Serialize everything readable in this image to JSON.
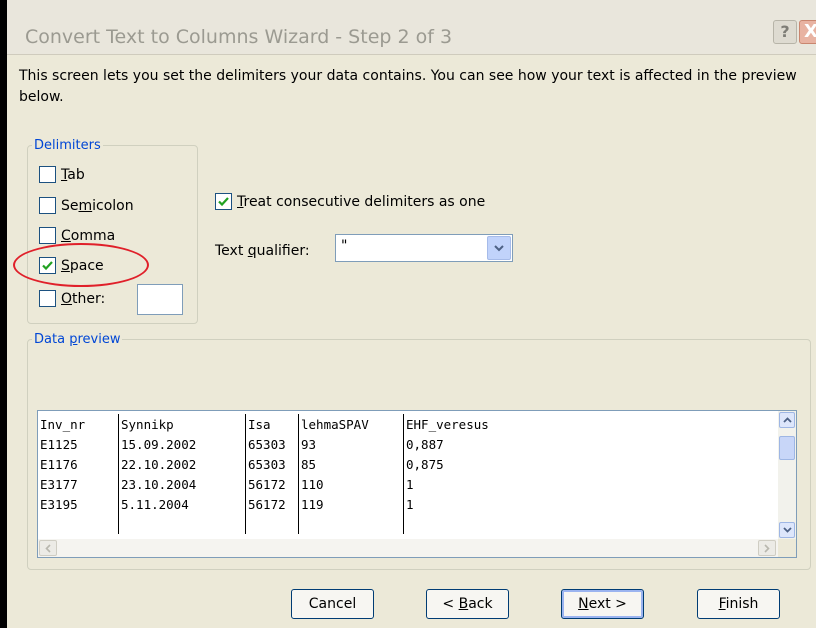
{
  "window": {
    "title": "Convert Text to Columns Wizard - Step 2 of 3",
    "help_glyph": "?",
    "close_glyph": "X"
  },
  "intro": "This screen lets you set the delimiters your data contains.  You can see how your text is affected in the preview below.",
  "delimiters": {
    "legend": "Delimiters",
    "options": [
      {
        "label": "Tab",
        "accesskey": "T",
        "checked": false
      },
      {
        "label": "Semicolon",
        "accesskey": "m",
        "checked": false
      },
      {
        "label": "Comma",
        "accesskey": "C",
        "checked": false
      },
      {
        "label": "Space",
        "accesskey": "S",
        "checked": true
      },
      {
        "label": "Other:",
        "accesskey": "O",
        "checked": false
      }
    ],
    "other_value": ""
  },
  "consecutive": {
    "label": "Treat consecutive delimiters as one",
    "accesskey": "T",
    "checked": true
  },
  "qualifier": {
    "label": "Text qualifier:",
    "accesskey": "q",
    "value": "\""
  },
  "preview": {
    "legend": "Data preview",
    "rows": [
      [
        "Inv_nr",
        "Synnikp",
        "Isa",
        "lehmaSPAV",
        "EHF_veresus"
      ],
      [
        "E1125",
        "15.09.2002",
        "65303",
        "93",
        "0,887"
      ],
      [
        "E1176",
        "22.10.2002",
        "65303",
        "85",
        "0,875"
      ],
      [
        "E3177",
        "23.10.2004",
        "56172",
        "110",
        "1"
      ],
      [
        "E3195",
        "5.11.2004",
        "56172",
        "119",
        "1"
      ],
      [
        "",
        "",
        "",
        "",
        ""
      ]
    ]
  },
  "buttons": {
    "cancel": "Cancel",
    "back": {
      "pre": "< ",
      "key": "B",
      "rest": "ack"
    },
    "next": {
      "pre": "",
      "key": "N",
      "rest": "ext >"
    },
    "finish": {
      "pre": "",
      "key": "F",
      "rest": "inish"
    }
  },
  "colors": {
    "accent_blue": "#0046d5",
    "highlight_circle": "#e0202a",
    "check_green": "#21a121"
  }
}
